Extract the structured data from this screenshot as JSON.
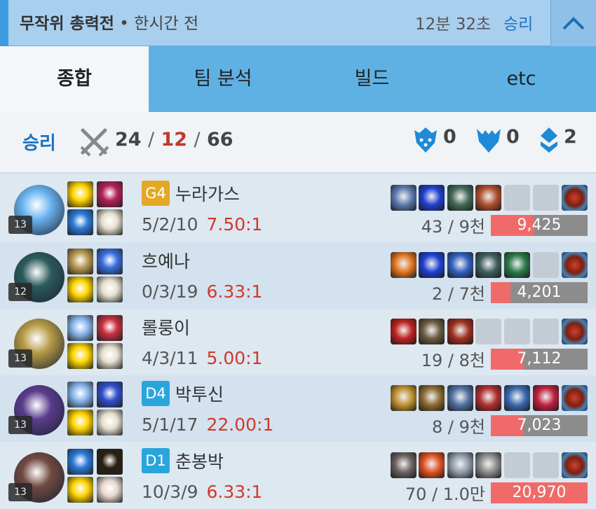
{
  "header": {
    "mode": "무작위 총력전",
    "time_ago": "• 한시간 전",
    "duration": "12분 32초",
    "result": "승리"
  },
  "tabs": [
    {
      "label": "종합",
      "active": true
    },
    {
      "label": "팀 분석",
      "active": false
    },
    {
      "label": "빌드",
      "active": false
    },
    {
      "label": "etc",
      "active": false
    }
  ],
  "summary": {
    "result": "승리",
    "kills": "24",
    "deaths": "12",
    "assists": "66",
    "slash": "/",
    "objectives": [
      {
        "icon": "tower-icon",
        "value": "0"
      },
      {
        "icon": "dragon-icon",
        "value": "0"
      },
      {
        "icon": "inhibitor-icon",
        "value": "2"
      }
    ]
  },
  "colors": {
    "win": "#1c72c4",
    "deaths": "#c0392b",
    "damage_fill": "#f06a6a",
    "damage_bg": "#8c8c8c"
  },
  "players": [
    {
      "name": "누라가스",
      "tier": "G4",
      "tier_color": "#e3a826",
      "level": "13",
      "kda": "5/2/10",
      "ratio": "7.50:1",
      "cs": "43 / 9천",
      "damage": "9,425",
      "damage_fraction": 0.45,
      "champ_color": "#6ab4f0",
      "spells": [
        "#ffd500",
        "#b5205a",
        "#2a7ad8",
        "#e6e0d0"
      ],
      "items": [
        "#5a7bb0",
        "#1e40d0",
        "#446a5a",
        "#b05030",
        "",
        ""
      ]
    },
    {
      "name": "흐예나",
      "tier": "",
      "tier_color": "",
      "level": "12",
      "kda": "0/3/19",
      "ratio": "6.33:1",
      "cs": "2 / 7천",
      "damage": "4,201",
      "damage_fraction": 0.2,
      "champ_color": "#2c5b5c",
      "spells": [
        "#b89b52",
        "#3a6fe0",
        "#ffd500",
        "#e6e0d0"
      ],
      "items": [
        "#e07520",
        "#1e40d0",
        "#3060c0",
        "#3e6060",
        "#2c7a4a",
        ""
      ]
    },
    {
      "name": "롤룽이",
      "tier": "",
      "tier_color": "",
      "level": "13",
      "kda": "4/3/11",
      "ratio": "5.00:1",
      "cs": "19 / 8천",
      "damage": "7,112",
      "damage_fraction": 0.34,
      "champ_color": "#b59a45",
      "spells": [
        "#8ab8f0",
        "#c83040",
        "#ffd500",
        "#e6e0d0"
      ],
      "items": [
        "#c02020",
        "#6a5a40",
        "#a03020",
        "",
        "",
        ""
      ]
    },
    {
      "name": "박투신",
      "tier": "D4",
      "tier_color": "#2aa5dc",
      "level": "13",
      "kda": "5/1/17",
      "ratio": "22.00:1",
      "cs": "8 / 9천",
      "damage": "7,023",
      "damage_fraction": 0.33,
      "champ_color": "#5a3c8c",
      "spells": [
        "#8ab8f0",
        "#3050d0",
        "#ffd500",
        "#e6e0d0"
      ],
      "items": [
        "#c09030",
        "#8a6a30",
        "#5070a0",
        "#b03030",
        "#3a6ab0",
        "#c02040"
      ]
    },
    {
      "name": "춘봉박",
      "tier": "D1",
      "tier_color": "#2aa5dc",
      "level": "13",
      "kda": "10/3/9",
      "ratio": "6.33:1",
      "cs": "70 / 1.0만",
      "damage": "20,970",
      "damage_fraction": 1.0,
      "champ_color": "#704a40",
      "spells": [
        "#2a7ad8",
        "#2a2010",
        "#ffd500",
        "#e8d8d0"
      ],
      "items": [
        "#6a6060",
        "#e05020",
        "#909aa8",
        "#8a8a8a",
        "",
        ""
      ]
    }
  ]
}
